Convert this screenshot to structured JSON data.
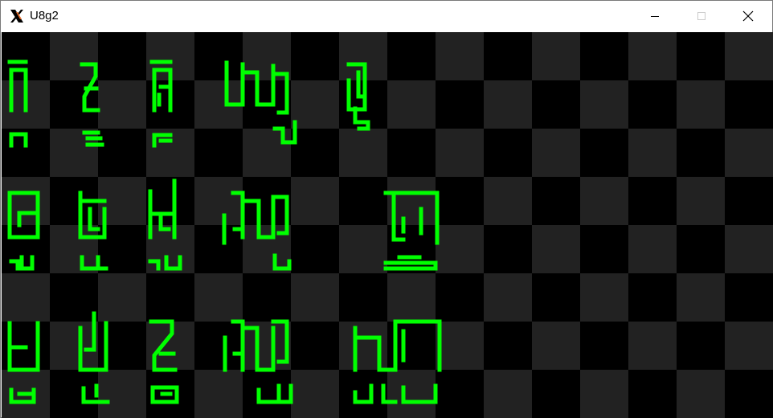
{
  "window": {
    "title": "U8g2",
    "app_icon": "x-logo-icon",
    "controls": {
      "minimize_icon": "minimize-icon",
      "maximize_icon": "maximize-icon",
      "close_icon": "close-icon"
    }
  },
  "display": {
    "background_dark": "#000000",
    "background_light": "#222222",
    "pixel_color": "#00ff00",
    "checker_cells": [
      16,
      8
    ]
  }
}
